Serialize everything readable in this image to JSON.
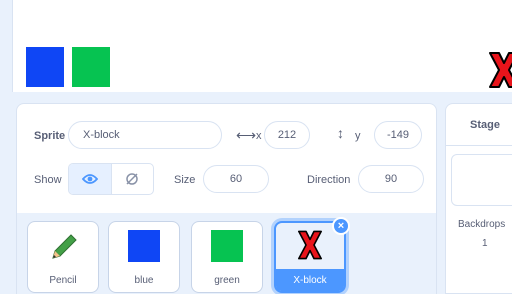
{
  "stage_preview": {
    "sprites": [
      {
        "name": "blue",
        "color": "#0f46f5"
      },
      {
        "name": "green",
        "color": "#06c351"
      },
      {
        "name": "X-block",
        "icon": "red-x-icon"
      }
    ]
  },
  "sprite_info": {
    "sprite_label": "Sprite",
    "sprite_name": "X-block",
    "x_label": "x",
    "x_value": "212",
    "y_label": "y",
    "y_value": "-149",
    "show_label": "Show",
    "size_label": "Size",
    "size_value": "60",
    "direction_label": "Direction",
    "direction_value": "90"
  },
  "sprite_tiles": [
    {
      "name": "Pencil",
      "icon": "pencil-icon",
      "selected": false
    },
    {
      "name": "blue",
      "color": "#0f46f5",
      "selected": false
    },
    {
      "name": "green",
      "color": "#06c351",
      "selected": false
    },
    {
      "name": "X-block",
      "icon": "red-x-icon",
      "selected": true
    }
  ],
  "stage_panel": {
    "title": "Stage",
    "backdrops_label": "Backdrops",
    "backdrops_count": "1"
  },
  "colors": {
    "accent": "#4c97ff",
    "text": "#575e75",
    "panel_bg": "#e9f1fc"
  }
}
